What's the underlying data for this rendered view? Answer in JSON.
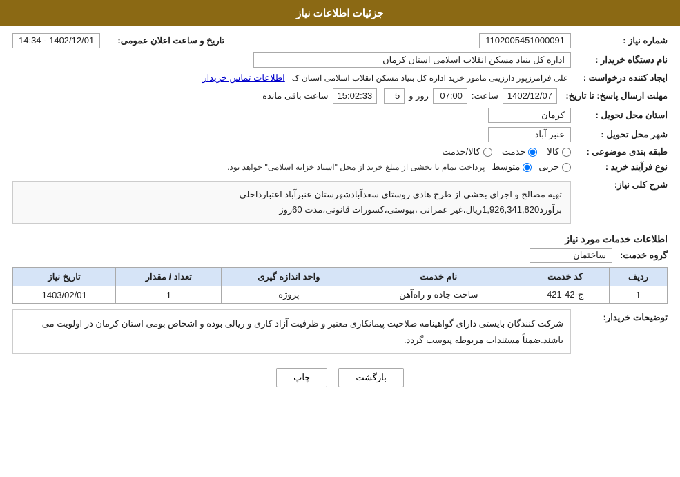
{
  "header": {
    "title": "جزئیات اطلاعات نیاز"
  },
  "fields": {
    "need_number_label": "شماره نیاز :",
    "need_number_value": "1102005451000091",
    "buyer_org_label": "نام دستگاه خریدار :",
    "buyer_org_value": "اداره کل بنیاد مسکن انقلاب اسلامی استان کرمان",
    "requester_label": "ایجاد کننده درخواست :",
    "requester_value": "علی فرامرزپور دارزینی مامور خرید اداره کل بنیاد مسکن انقلاب اسلامی استان ک",
    "requester_link": "اطلاعات تماس خریدار",
    "reply_deadline_label": "مهلت ارسال پاسخ: تا تاریخ:",
    "date_value": "1402/12/07",
    "time_label": "ساعت:",
    "time_value": "07:00",
    "day_label": "روز و",
    "day_value": "5",
    "remaining_label": "ساعت باقی مانده",
    "remaining_value": "15:02:33",
    "announcement_label": "تاریخ و ساعت اعلان عمومی:",
    "announcement_value": "1402/12/01 - 14:34",
    "province_label": "استان محل تحویل :",
    "province_value": "کرمان",
    "city_label": "شهر محل تحویل :",
    "city_value": "عنبر آباد",
    "category_label": "طبقه بندی موضوعی :",
    "category_options": [
      {
        "label": "کالا",
        "value": "kala"
      },
      {
        "label": "خدمت",
        "value": "khadamat"
      },
      {
        "label": "کالا/خدمت",
        "value": "kala_khadamat"
      }
    ],
    "category_selected": "khadamat",
    "process_label": "نوع فرآیند خرید :",
    "process_options": [
      {
        "label": "جزیی",
        "value": "jozii"
      },
      {
        "label": "متوسط",
        "value": "motavaset"
      }
    ],
    "process_selected": "motavaset",
    "process_note": "پرداخت تمام یا بخشی از مبلغ خرید از محل \"اسناد خزانه اسلامی\" خواهد بود.",
    "need_desc_label": "شرح کلی نیاز:",
    "need_desc_value": "تهیه مصالح و اجرای بخشی از طرح هادی روستای سعدآبادشهرستان عنبرآباد اعتبارداخلی\nبرآورد1,926,341,820ریال،غیر عمرانی ،بیوستی،کسورات قانونی،مدت 60روز",
    "services_section_title": "اطلاعات خدمات مورد نیاز",
    "service_group_label": "گروه خدمت:",
    "service_group_value": "ساختمان",
    "table_headers": [
      "ردیف",
      "کد خدمت",
      "نام خدمت",
      "واحد اندازه گیری",
      "تعداد / مقدار",
      "تاریخ نیاز"
    ],
    "table_rows": [
      {
        "row": "1",
        "code": "ج-42-421",
        "name": "ساخت جاده و راه‌آهن",
        "unit": "پروژه",
        "qty": "1",
        "date": "1403/02/01"
      }
    ],
    "buyer_notes_label": "توضیحات خریدار:",
    "buyer_notes_value": "شرکت کنندگان بایستی دارای گواهینامه صلاحیت پیمانکاری معتبر و ظرفیت آزاد کاری و ریالی بوده و اشخاص بومی استان کرمان در اولویت می باشند.ضمناً مستندات مربوطه پیوست گردد.",
    "btn_print": "چاپ",
    "btn_back": "بازگشت"
  }
}
